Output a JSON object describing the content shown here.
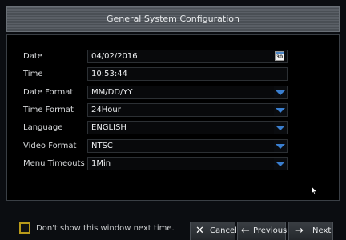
{
  "window": {
    "title": "General System Configuration"
  },
  "fields": {
    "date": {
      "label": "Date",
      "value": "04/02/2016",
      "icon": "calendar-icon",
      "icon_text": "30"
    },
    "time": {
      "label": "Time",
      "value": "10:53:44"
    },
    "date_format": {
      "label": "Date Format",
      "value": "MM/DD/YY"
    },
    "time_format": {
      "label": "Time Format",
      "value": "24Hour"
    },
    "language": {
      "label": "Language",
      "value": "ENGLISH"
    },
    "video_format": {
      "label": "Video Format",
      "value": "NTSC"
    },
    "menu_timeouts": {
      "label": "Menu Timeouts",
      "value": "1Min"
    }
  },
  "footer": {
    "dont_show_label": "Don't show this window next time.",
    "cancel_label": "Cancel",
    "previous_label": "Previous",
    "next_label": "Next"
  },
  "colors": {
    "accent": "#3a7fd0",
    "checkbox_border": "#b99a1a"
  }
}
